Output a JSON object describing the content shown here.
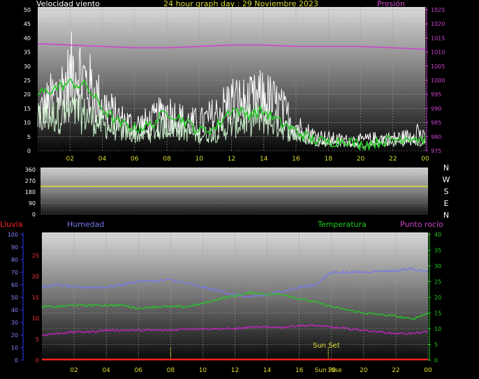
{
  "header": {
    "wind_label": "Velocidad viento",
    "title": "24 hour graph day : 29 Noviembre 2023",
    "pressure_label": "Presión"
  },
  "bottom_labels": {
    "rain": "Lluvia",
    "humidity": "Humedad",
    "temperature": "Temperatura",
    "dewpoint": "Punto rocío",
    "sunset": "Sun Set",
    "sunrise": "Sun Rise"
  },
  "compass": [
    "N",
    "W",
    "S",
    "E",
    "N"
  ],
  "colors": {
    "wind_gust": "#ffffff",
    "wind_speed": "#c8f0c8",
    "wind_avg": "#22cc22",
    "pressure": "#cc44cc",
    "direction": "#dddd33",
    "humidity": "#7777ee",
    "temperature": "#22cc22",
    "dewpoint": "#cc22cc",
    "rain": "#ff2222",
    "sun_marker": "#dddd33"
  },
  "chart_data": [
    {
      "type": "line",
      "name": "wind-pressure",
      "x_ticks": [
        "02",
        "04",
        "06",
        "08",
        "10",
        "12",
        "14",
        "16",
        "18",
        "20",
        "22",
        "00"
      ],
      "xlim": [
        0,
        24
      ],
      "ylim_left": [
        0,
        50
      ],
      "yticks_left": [
        0,
        5,
        10,
        15,
        20,
        25,
        30,
        35,
        40,
        45,
        50
      ],
      "ylim_right": [
        975,
        1025
      ],
      "yticks_right": [
        975,
        980,
        985,
        990,
        995,
        1000,
        1005,
        1010,
        1015,
        1020,
        1025
      ],
      "series": [
        {
          "name": "Velocidad viento",
          "kind": "gust",
          "x": [
            0,
            1,
            2,
            2.3,
            3,
            4,
            5,
            6,
            7,
            8,
            9,
            10,
            11,
            12,
            13,
            14,
            15,
            16,
            17,
            18,
            19,
            20,
            21,
            22,
            23,
            23.5,
            24
          ],
          "values": [
            20,
            30,
            40,
            48,
            38,
            26,
            18,
            14,
            16,
            22,
            17,
            15,
            20,
            28,
            26,
            30,
            24,
            14,
            9,
            7,
            6,
            6,
            7,
            7,
            8,
            12,
            6
          ]
        },
        {
          "name": "wind speed",
          "kind": "speed",
          "x": [
            0,
            1,
            2,
            3,
            4,
            5,
            6,
            7,
            8,
            9,
            10,
            11,
            12,
            13,
            14,
            15,
            16,
            17,
            18,
            19,
            20,
            21,
            22,
            23,
            24
          ],
          "values": [
            12,
            14,
            15,
            14,
            10,
            8,
            6,
            7,
            10,
            8,
            6,
            7,
            10,
            12,
            13,
            10,
            6,
            4,
            3,
            3,
            2,
            3,
            3,
            4,
            3
          ]
        },
        {
          "name": "wind average",
          "kind": "avg",
          "x": [
            0,
            1,
            2,
            3,
            4,
            5,
            6,
            7,
            8,
            9,
            10,
            11,
            12,
            13,
            14,
            15,
            16,
            17,
            18,
            19,
            20,
            21,
            22,
            23,
            24
          ],
          "values": [
            20,
            22,
            24,
            23,
            15,
            10,
            8,
            9,
            14,
            11,
            7,
            8,
            15,
            13,
            14,
            10,
            7,
            4,
            3,
            4,
            2,
            3,
            4,
            5,
            4
          ]
        },
        {
          "name": "Presión",
          "kind": "pressure",
          "x": [
            0,
            2,
            4,
            6,
            8,
            10,
            12,
            14,
            16,
            18,
            20,
            22,
            24
          ],
          "values": [
            1013,
            1012.5,
            1012,
            1011.5,
            1011.5,
            1012,
            1012.5,
            1012.5,
            1012,
            1012,
            1012,
            1011.5,
            1011
          ]
        }
      ]
    },
    {
      "type": "line",
      "name": "wind-direction",
      "ylim": [
        0,
        360
      ],
      "yticks": [
        0,
        90,
        180,
        270,
        360
      ],
      "series": [
        {
          "name": "direction",
          "x": [
            0,
            24
          ],
          "values": [
            225,
            225
          ]
        }
      ]
    },
    {
      "type": "line",
      "name": "humidity-temperature",
      "x_ticks": [
        "02",
        "04",
        "06",
        "08",
        "10",
        "12",
        "14",
        "16",
        "18",
        "20",
        "22",
        "00"
      ],
      "xlim": [
        0,
        24
      ],
      "yticks_rain": [
        0,
        10,
        20,
        30,
        40,
        50,
        60,
        70,
        80,
        90,
        100
      ],
      "yticks_inner": [
        0,
        5,
        10,
        15,
        20,
        25
      ],
      "ylim_right": [
        0,
        40
      ],
      "yticks_right": [
        0,
        5,
        10,
        15,
        20,
        25,
        30,
        35,
        40
      ],
      "sunrise_x": 8,
      "sunset_x": 17.8,
      "series": [
        {
          "name": "Humedad",
          "x": [
            0,
            1,
            2,
            3,
            4,
            5,
            6,
            7,
            8,
            9,
            10,
            11,
            12,
            13,
            14,
            15,
            16,
            17,
            18,
            19,
            20,
            21,
            22,
            23,
            24
          ],
          "values": [
            58,
            60,
            58,
            58,
            58,
            60,
            63,
            63,
            64,
            61,
            58,
            55,
            52,
            50,
            52,
            55,
            58,
            60,
            70,
            70,
            70,
            71,
            71,
            73,
            70
          ]
        },
        {
          "name": "Temperatura",
          "x": [
            0,
            1,
            2,
            3,
            4,
            5,
            6,
            7,
            8,
            9,
            10,
            11,
            12,
            13,
            14,
            15,
            16,
            17,
            18,
            19,
            20,
            21,
            22,
            23,
            24
          ],
          "values": [
            17,
            17,
            17.5,
            17.5,
            17.5,
            17.5,
            16.5,
            17,
            17,
            17,
            18,
            19.5,
            20.5,
            21.5,
            21,
            21,
            19.5,
            18.5,
            17,
            16,
            15,
            14.5,
            14,
            13,
            15
          ]
        },
        {
          "name": "Punto rocío",
          "x": [
            0,
            1,
            2,
            3,
            4,
            5,
            6,
            7,
            8,
            9,
            10,
            11,
            12,
            13,
            14,
            15,
            16,
            17,
            18,
            19,
            20,
            21,
            22,
            23,
            24
          ],
          "values": [
            8,
            8.5,
            9,
            9,
            9.5,
            9.5,
            9.5,
            9.5,
            9.5,
            10,
            10,
            10,
            10,
            10.5,
            10.5,
            10.5,
            11,
            11,
            10.5,
            10,
            9.5,
            9,
            8.5,
            8.5,
            9
          ]
        },
        {
          "name": "Lluvia",
          "x": [
            0,
            24
          ],
          "values": [
            0,
            0
          ]
        }
      ]
    }
  ]
}
